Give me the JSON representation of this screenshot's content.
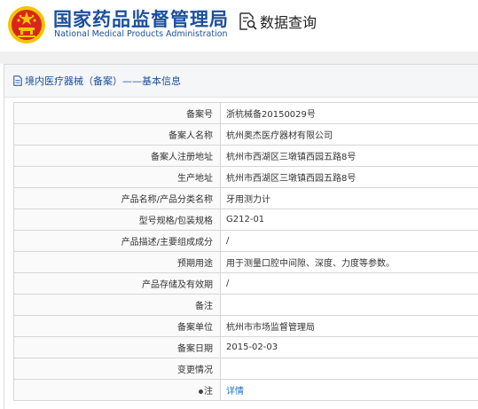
{
  "header": {
    "org_name_cn": "国家药品监督管理局",
    "org_name_en": "National Medical Products Administration",
    "emblem_icon": "national-emblem-icon",
    "query_icon": "document-search-icon",
    "query_title": "数据查询"
  },
  "section": {
    "icon": "document-icon",
    "title": "境内医疗器械（备案）——基本信息"
  },
  "rows": [
    {
      "label": "备案号",
      "value": "浙杭械备20150029号"
    },
    {
      "label": "备案人名称",
      "value": "杭州奥杰医疗器材有限公司"
    },
    {
      "label": "备案人注册地址",
      "value": "杭州市西湖区三墩镇西园五路8号"
    },
    {
      "label": "生产地址",
      "value": "杭州市西湖区三墩镇西园五路8号"
    },
    {
      "label": "产品名称/产品分类名称",
      "value": "牙用测力计"
    },
    {
      "label": "型号规格/包装规格",
      "value": "G212-01"
    },
    {
      "label": "产品描述/主要组成成分",
      "value": "/"
    },
    {
      "label": "预期用途",
      "value": "用于测量口腔中间隙、深度、力度等参数。"
    },
    {
      "label": "产品存储及有效期",
      "value": "/"
    },
    {
      "label": "备注",
      "value": ""
    },
    {
      "label": "备案单位",
      "value": "杭州市市场监督管理局"
    },
    {
      "label": "备案日期",
      "value": "2015-02-03"
    },
    {
      "label": "变更情况",
      "value": ""
    }
  ],
  "note_row": {
    "label": "注",
    "link_text": "详情"
  },
  "colors": {
    "brand_blue": "#1b4f9c",
    "link_blue": "#1b6fc4",
    "emblem_red": "#d7261e",
    "emblem_gold": "#f5c400"
  }
}
